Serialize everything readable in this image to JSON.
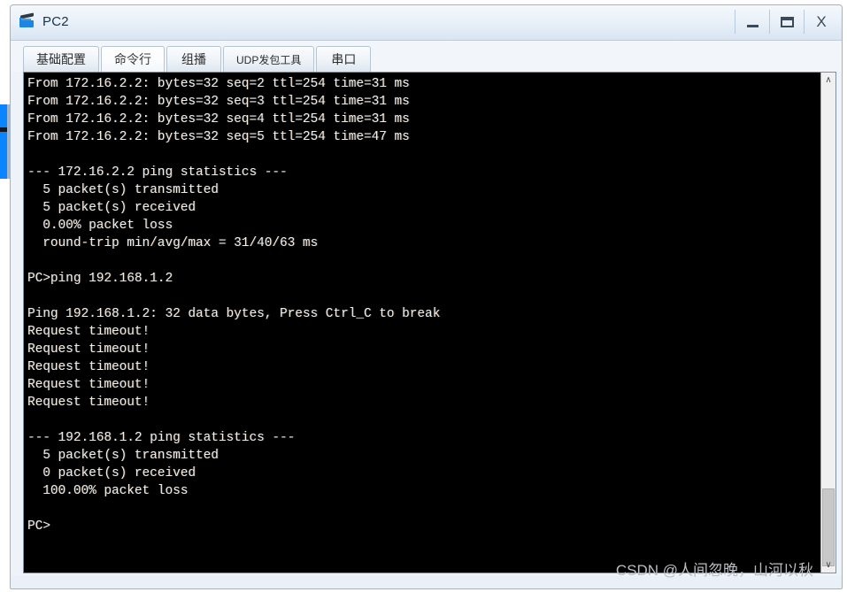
{
  "window": {
    "title": "PC2",
    "icon": "pc-device-icon",
    "controls": {
      "minimize": "–",
      "maximize": "❐",
      "close": "X"
    }
  },
  "tabs": [
    {
      "label": "基础配置",
      "active": false
    },
    {
      "label": "命令行",
      "active": true
    },
    {
      "label": "组播",
      "active": false
    },
    {
      "label": "UDP发包工具",
      "active": false,
      "small": true
    },
    {
      "label": "串口",
      "active": false
    }
  ],
  "terminal": {
    "background": "#000000",
    "foreground": "#eceff1",
    "lines": [
      "From 172.16.2.2: bytes=32 seq=2 ttl=254 time=31 ms",
      "From 172.16.2.2: bytes=32 seq=3 ttl=254 time=31 ms",
      "From 172.16.2.2: bytes=32 seq=4 ttl=254 time=31 ms",
      "From 172.16.2.2: bytes=32 seq=5 ttl=254 time=47 ms",
      "",
      "--- 172.16.2.2 ping statistics ---",
      "  5 packet(s) transmitted",
      "  5 packet(s) received",
      "  0.00% packet loss",
      "  round-trip min/avg/max = 31/40/63 ms",
      "",
      "PC>ping 192.168.1.2",
      "",
      "Ping 192.168.1.2: 32 data bytes, Press Ctrl_C to break",
      "Request timeout!",
      "Request timeout!",
      "Request timeout!",
      "Request timeout!",
      "Request timeout!",
      "",
      "--- 192.168.1.2 ping statistics ---",
      "  5 packet(s) transmitted",
      "  0 packet(s) received",
      "  100.00% packet loss",
      "",
      "PC>"
    ]
  },
  "scrollbar": {
    "up_arrow": "∧",
    "down_arrow": "∨"
  },
  "watermark": {
    "text": "CSDN @人间忽晚，山河以秋"
  }
}
